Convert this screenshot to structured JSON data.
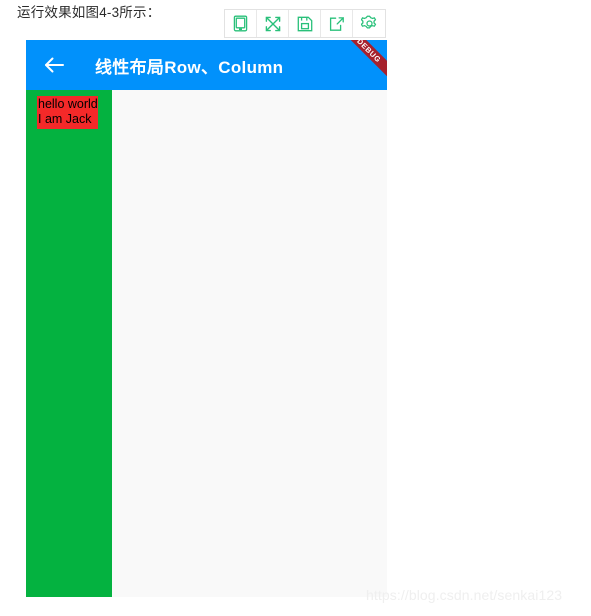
{
  "caption": {
    "text": "运行效果如图4-3所示："
  },
  "toolbar": {
    "buttons": [
      {
        "label": "Device frame",
        "icon": "phone-icon"
      },
      {
        "label": "Resize",
        "icon": "expand-arrows-icon"
      },
      {
        "label": "Save screenshot",
        "icon": "floppy-save-icon"
      },
      {
        "label": "Share",
        "icon": "share-export-icon"
      },
      {
        "label": "Settings",
        "icon": "gear-icon"
      }
    ]
  },
  "phone": {
    "appbar": {
      "back_icon": "back-arrow-icon",
      "title": "线性布局Row、Column",
      "debug_banner": "DEBUG",
      "background_color": "#0191fb",
      "title_color": "#ffffff"
    },
    "body": {
      "background_color": "#f9f9f9",
      "column": {
        "background_color": "#04b240",
        "box": {
          "background_color": "#f42929",
          "text_color": "#000000",
          "lines": [
            "hello world",
            "I am Jack"
          ]
        }
      }
    }
  },
  "watermark": {
    "text": "https://blog.csdn.net/senkai123"
  }
}
